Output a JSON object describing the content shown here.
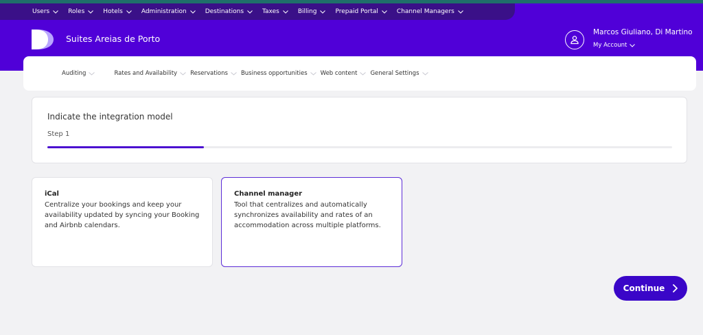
{
  "top_nav": [
    {
      "label": "Users"
    },
    {
      "label": "Roles"
    },
    {
      "label": "Hotels"
    },
    {
      "label": "Administration"
    },
    {
      "label": "Destinations"
    },
    {
      "label": "Taxes"
    },
    {
      "label": "Billing"
    },
    {
      "label": "Prepaid Portal"
    },
    {
      "label": "Channel Managers"
    }
  ],
  "header": {
    "hotel_name": "Suites Areias de Porto",
    "user_name": "Marcos Giuliano, Di Martino",
    "my_account": "My Account"
  },
  "sub_nav": [
    {
      "label": "Auditing"
    },
    {
      "label": "Rates and Availability"
    },
    {
      "label": "Reservations"
    },
    {
      "label": "Business opportunities"
    },
    {
      "label": "Web content"
    },
    {
      "label": "General Settings"
    }
  ],
  "step": {
    "title": "Indicate the integration model",
    "label": "Step 1",
    "progress": 0.25
  },
  "options": [
    {
      "title": "iCal",
      "description": "Centralize your bookings and keep your availability updated by syncing your Booking and Airbnb calendars.",
      "selected": false
    },
    {
      "title": "Channel manager",
      "description": "Tool that centralizes and automatically synchronizes availability and rates of an accommodation across multiple platforms.",
      "selected": true
    }
  ],
  "continue_label": "Continue",
  "colors": {
    "header": "#5000d8",
    "top_nav": "#3a1088",
    "accent": "#3a06c8"
  }
}
